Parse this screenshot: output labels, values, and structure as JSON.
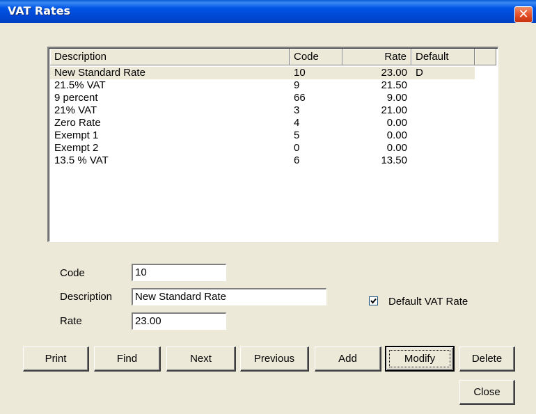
{
  "window": {
    "title": "VAT Rates",
    "close_glyph": "✕",
    "close_icon": "close-icon"
  },
  "list": {
    "columns": [
      "Description",
      "Code",
      "Rate",
      "Default"
    ],
    "rows": [
      {
        "description": "New Standard Rate",
        "code": "10",
        "rate": "23.00",
        "default": "D",
        "selected": true
      },
      {
        "description": "21.5% VAT",
        "code": "9",
        "rate": "21.50",
        "default": ""
      },
      {
        "description": "9 percent",
        "code": "66",
        "rate": "9.00",
        "default": ""
      },
      {
        "description": "21% VAT",
        "code": "3",
        "rate": "21.00",
        "default": ""
      },
      {
        "description": "Zero Rate",
        "code": "4",
        "rate": "0.00",
        "default": ""
      },
      {
        "description": "Exempt 1",
        "code": "5",
        "rate": "0.00",
        "default": ""
      },
      {
        "description": "Exempt 2",
        "code": "0",
        "rate": "0.00",
        "default": ""
      },
      {
        "description": "13.5 % VAT",
        "code": "6",
        "rate": "13.50",
        "default": ""
      }
    ]
  },
  "form": {
    "code_label": "Code",
    "code_value": "10",
    "description_label": "Description",
    "description_value": "New Standard Rate",
    "rate_label": "Rate",
    "rate_value": "23.00",
    "default_label": "Default VAT Rate",
    "default_checked": true
  },
  "buttons": {
    "print": "Print",
    "find": "Find",
    "next": "Next",
    "previous": "Previous",
    "add": "Add",
    "modify": "Modify",
    "delete": "Delete",
    "close": "Close"
  }
}
